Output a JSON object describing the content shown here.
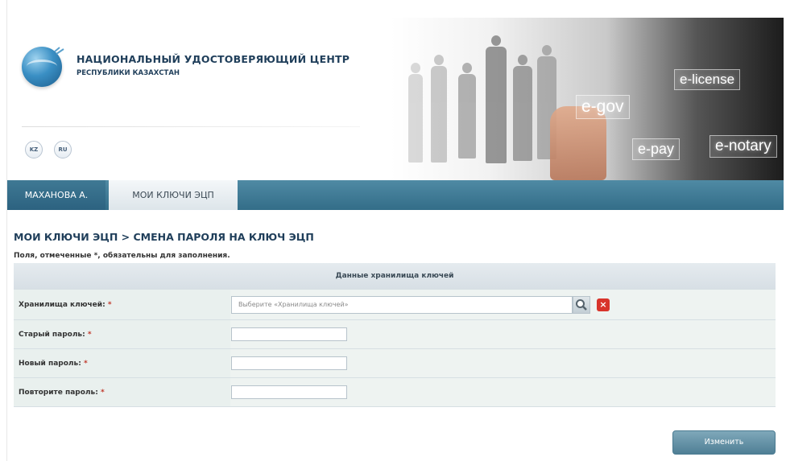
{
  "header": {
    "org_name": "НАЦИОНАЛЬНЫЙ УДОСТОВЕРЯЮЩИЙ ЦЕНТР",
    "org_subtitle": "РЕСПУБЛИКИ КАЗАХСТАН",
    "languages": [
      "KZ",
      "RU"
    ],
    "banner_services": [
      "e-license",
      "e-gov",
      "e-pay",
      "e-notary"
    ]
  },
  "nav": {
    "user_tab": "МАХАНОВА А.",
    "active_tab": "МОИ КЛЮЧИ ЭЦП"
  },
  "page": {
    "breadcrumb": "МОИ КЛЮЧИ ЭЦП > СМЕНА ПАРОЛЯ НА КЛЮЧ ЭЦП",
    "required_note": "Поля, отмеченные *, обязательны для заполнения."
  },
  "form": {
    "section_header": "Данные хранилища ключей",
    "required_mark": "*",
    "fields": [
      {
        "label": "Хранилища ключей:",
        "placeholder": "Выберите «Хранилища ключей»"
      },
      {
        "label": "Старый пароль:",
        "value": ""
      },
      {
        "label": "Новый пароль:",
        "value": ""
      },
      {
        "label": "Повторите пароль:",
        "value": ""
      }
    ],
    "submit_label": "Изменить"
  },
  "colors": {
    "nav_bar": "#3f7994",
    "heading_text": "#1f3e5a",
    "required_mark": "#c0392b",
    "clear_button": "#d8342b",
    "submit_button": "#5f8da2"
  },
  "icons": [
    "globe-logo-icon",
    "search-icon",
    "close-icon"
  ]
}
